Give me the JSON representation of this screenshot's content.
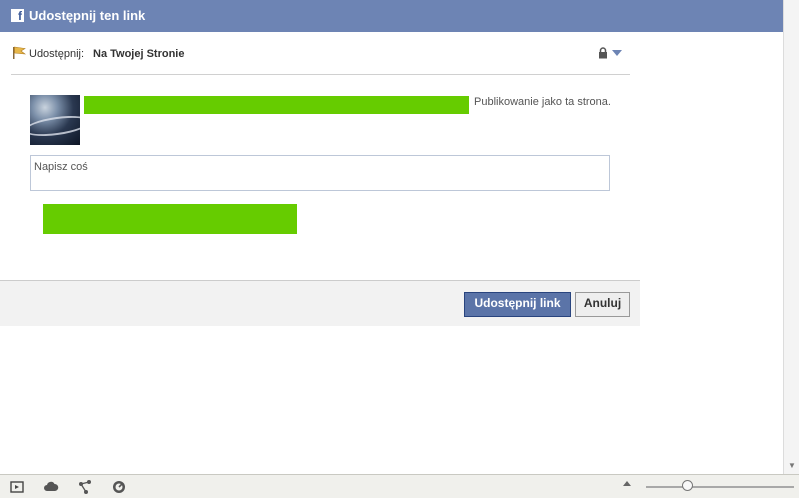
{
  "dialog": {
    "title": "Udostępnij ten link",
    "title_icon": "facebook-f-icon"
  },
  "share": {
    "label": "Udostępnij:",
    "target": "Na Twojej Stronie",
    "privacy_icon": "lock-icon"
  },
  "poster": {
    "posting_as": "Publikowanie jako ta strona."
  },
  "compose": {
    "placeholder": "Napisz coś"
  },
  "buttons": {
    "share": "Udostępnij link",
    "cancel": "Anuluj"
  },
  "colors": {
    "title_bar": "#6d84b4",
    "primary_button": "#5b74a8",
    "redaction": "#66cc00"
  },
  "statusbar": {
    "icons": [
      "window-icon",
      "cloud-icon",
      "share-nodes-icon",
      "speedometer-icon"
    ],
    "zoom_level": 0.25
  }
}
